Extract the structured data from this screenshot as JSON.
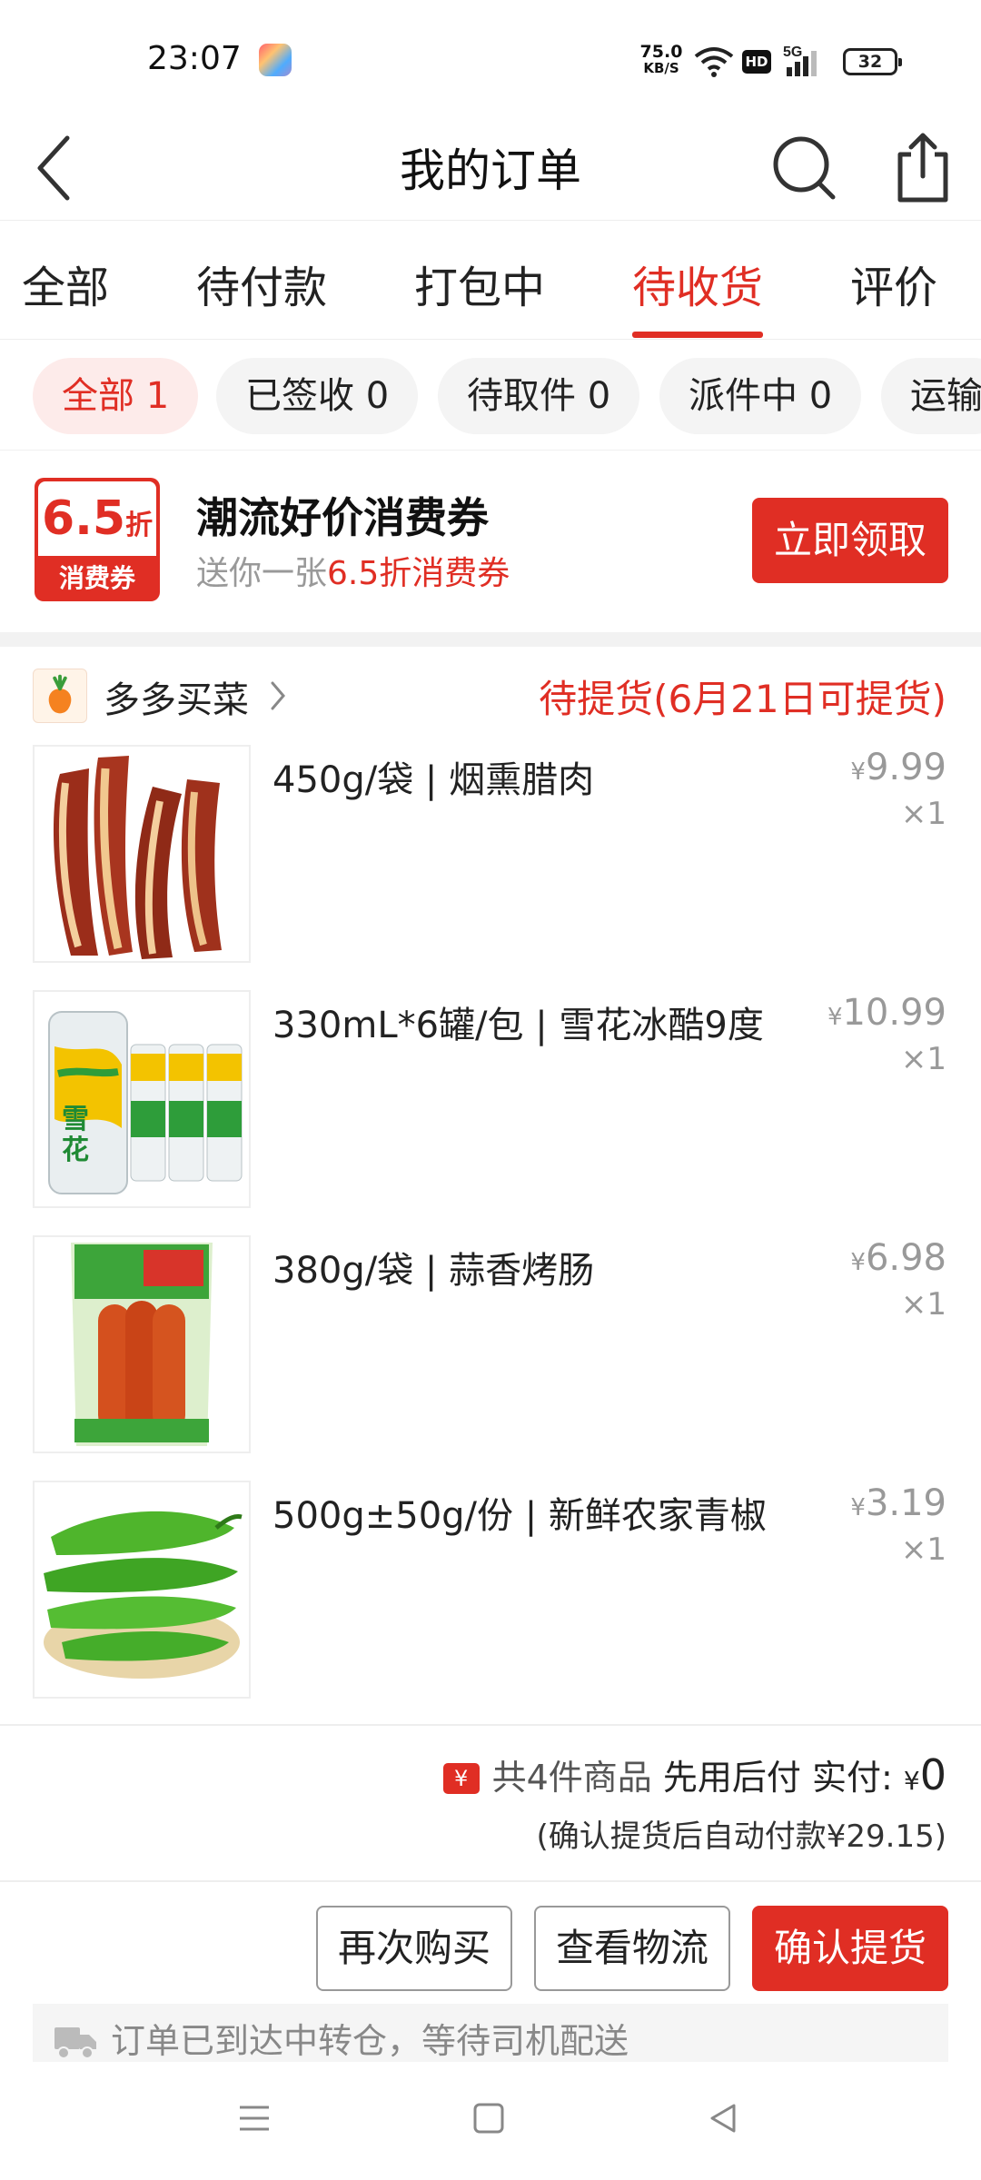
{
  "status_bar": {
    "time": "23:07",
    "net_speed_value": "75.0",
    "net_speed_unit": "KB/S",
    "hd_label": "HD",
    "network_label": "5G",
    "battery": "32"
  },
  "nav": {
    "title": "我的订单"
  },
  "tabs": [
    {
      "label": "全部"
    },
    {
      "label": "待付款"
    },
    {
      "label": "打包中"
    },
    {
      "label": "待收货",
      "active": true
    },
    {
      "label": "评价"
    }
  ],
  "chips": [
    {
      "label": "全部 1",
      "active": true
    },
    {
      "label": "已签收 0"
    },
    {
      "label": "待取件 0"
    },
    {
      "label": "派件中 0"
    },
    {
      "label": "运输"
    }
  ],
  "coupon": {
    "badge_discount": "6.5",
    "badge_unit": "折",
    "badge_label": "消费券",
    "title": "潮流好价消费券",
    "subtitle_prefix": "送你一张",
    "subtitle_highlight": "6.5折消费券",
    "button_label": "立即领取"
  },
  "store": {
    "name": "多多买菜",
    "status": "待提货(6月21日可提货)"
  },
  "items": [
    {
      "title": "450g/袋 | 烟熏腊肉",
      "currency": "¥",
      "price": "9.99",
      "qty": "×1",
      "icon": "bacon-image"
    },
    {
      "title": "330mL*6罐/包 | 雪花冰酷9度",
      "currency": "¥",
      "price": "10.99",
      "qty": "×1",
      "icon": "beer-cans-image"
    },
    {
      "title": "380g/袋 | 蒜香烤肠",
      "currency": "¥",
      "price": "6.98",
      "qty": "×1",
      "icon": "sausage-image"
    },
    {
      "title": "500g±50g/份 | 新鲜农家青椒",
      "currency": "¥",
      "price": "3.19",
      "qty": "×1",
      "icon": "green-pepper-image"
    }
  ],
  "summary": {
    "icon": "¥",
    "count_text": "共4件商品",
    "pay_mode": "先用后付",
    "paid_label": "实付:",
    "currency": "¥",
    "paid_value": "0",
    "note": "(确认提货后自动付款¥29.15)"
  },
  "actions": {
    "rebuy": "再次购买",
    "logistics": "查看物流",
    "confirm": "确认提货"
  },
  "notice": {
    "text": "订单已到达中转仓，等待司机配送"
  },
  "colors": {
    "accent": "#e02e24",
    "muted": "#999999"
  }
}
